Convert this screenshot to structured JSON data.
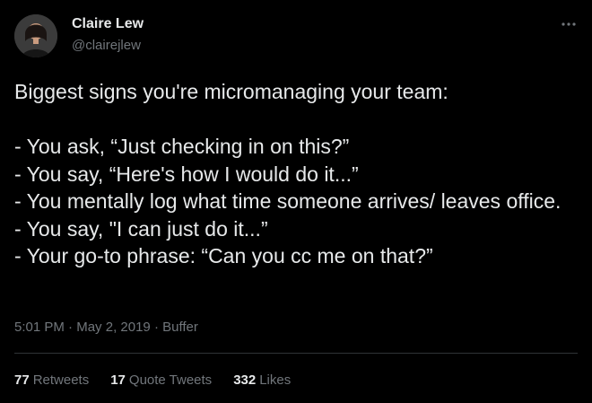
{
  "author": {
    "name": "Claire Lew",
    "handle": "@clairejlew"
  },
  "tweet": {
    "text": "Biggest signs you're micromanaging your team:\n\n- You ask, “Just checking in on this?”\n- You say, “Here's how I would do it...”\n- You mentally log what time someone arrives/ leaves office.\n- You say, \"I can just do it...”\n- Your go-to phrase:  “Can you cc me on that?”"
  },
  "meta": {
    "time": "5:01 PM",
    "sep1": "·",
    "date": "May 2, 2019",
    "sep2": "·",
    "source": "Buffer"
  },
  "stats": {
    "retweets_count": "77",
    "retweets_label": "Retweets",
    "quotes_count": "17",
    "quotes_label": "Quote Tweets",
    "likes_count": "332",
    "likes_label": "Likes"
  },
  "icons": {
    "more": "more-dots-icon",
    "avatar": "avatar"
  },
  "colors": {
    "background": "#000000",
    "text": "#e7e9ea",
    "muted": "#71767b",
    "divider": "#2f3336"
  }
}
